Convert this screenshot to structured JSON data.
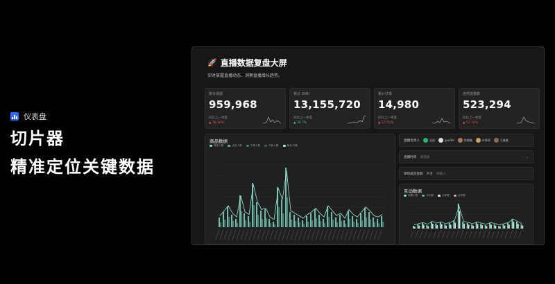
{
  "promo": {
    "tag": "仪表盘",
    "line1": "切片器",
    "line2": "精准定位关键数据"
  },
  "dashboard": {
    "title": "直播数据复盘大屏",
    "subtitle": "实时掌握直播动态、洞察直播增长趋势。",
    "kpis": [
      {
        "label": "累计场观",
        "value": "959,968",
        "compare": "同比上一季度",
        "change": "▲ 78.16%",
        "dir": "up"
      },
      {
        "label": "累计 GMV",
        "value": "13,155,720",
        "compare": "同比上一季度",
        "change": "▲ 78.7%",
        "dir": "ok"
      },
      {
        "label": "累计订单",
        "value": "14,980",
        "compare": "同比上一季度",
        "change": "▲ 57.51%",
        "dir": "up"
      },
      {
        "label": "自然流量数",
        "value": "523,294",
        "compare": "同比上一季度",
        "change": "▲ 51.74%",
        "dir": "up"
      }
    ],
    "product_panel": {
      "title": "商品数据",
      "legend": [
        "商品人数",
        "点击人数",
        "下单人数",
        "付款人数",
        "商品-付款"
      ]
    },
    "filters": {
      "host_label": "直播负责人",
      "hosts": [
        "全部",
        "guofab",
        "陈佛佛",
        "许晖晖",
        "王美美"
      ],
      "time_label": "直播时间",
      "time_placeholder": "请选择",
      "amount_label": "单场成交金额",
      "amount_op": "大于",
      "amount_placeholder": "请输入"
    },
    "interact_panel": {
      "title": "互动数据",
      "legend": [
        "观看人数",
        "评论数",
        "点赞数",
        "点赞数"
      ]
    }
  },
  "colors": {
    "bar": "#7fd6c2",
    "line": "#9ee7d7",
    "accent": "#2f6bff"
  }
}
